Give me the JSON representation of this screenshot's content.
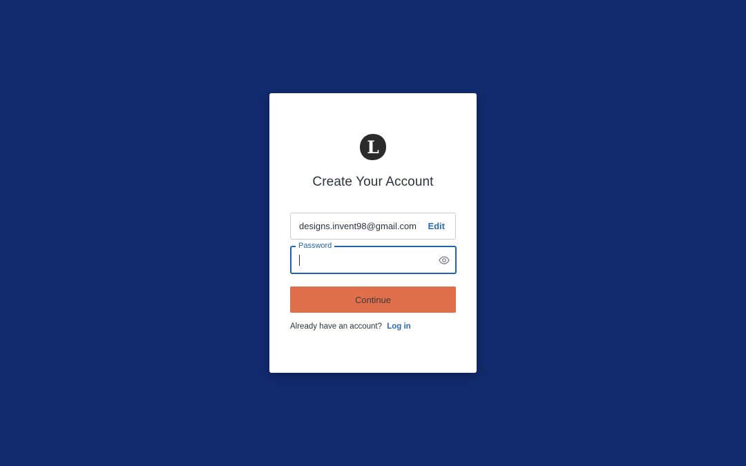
{
  "theme": {
    "background": "#122b6e",
    "accent": "#1f64ad",
    "primary_button": "#e0704c"
  },
  "logo": {
    "letter": "L",
    "icon": "brand-logo-icon"
  },
  "form": {
    "title": "Create Your Account",
    "email": {
      "value": "designs.invent98@gmail.com",
      "edit_label": "Edit"
    },
    "password": {
      "label": "Password",
      "value": "",
      "toggle_icon": "eye-icon"
    },
    "continue_label": "Continue",
    "footer": {
      "prompt": "Already have an account?",
      "login_label": "Log in"
    }
  }
}
